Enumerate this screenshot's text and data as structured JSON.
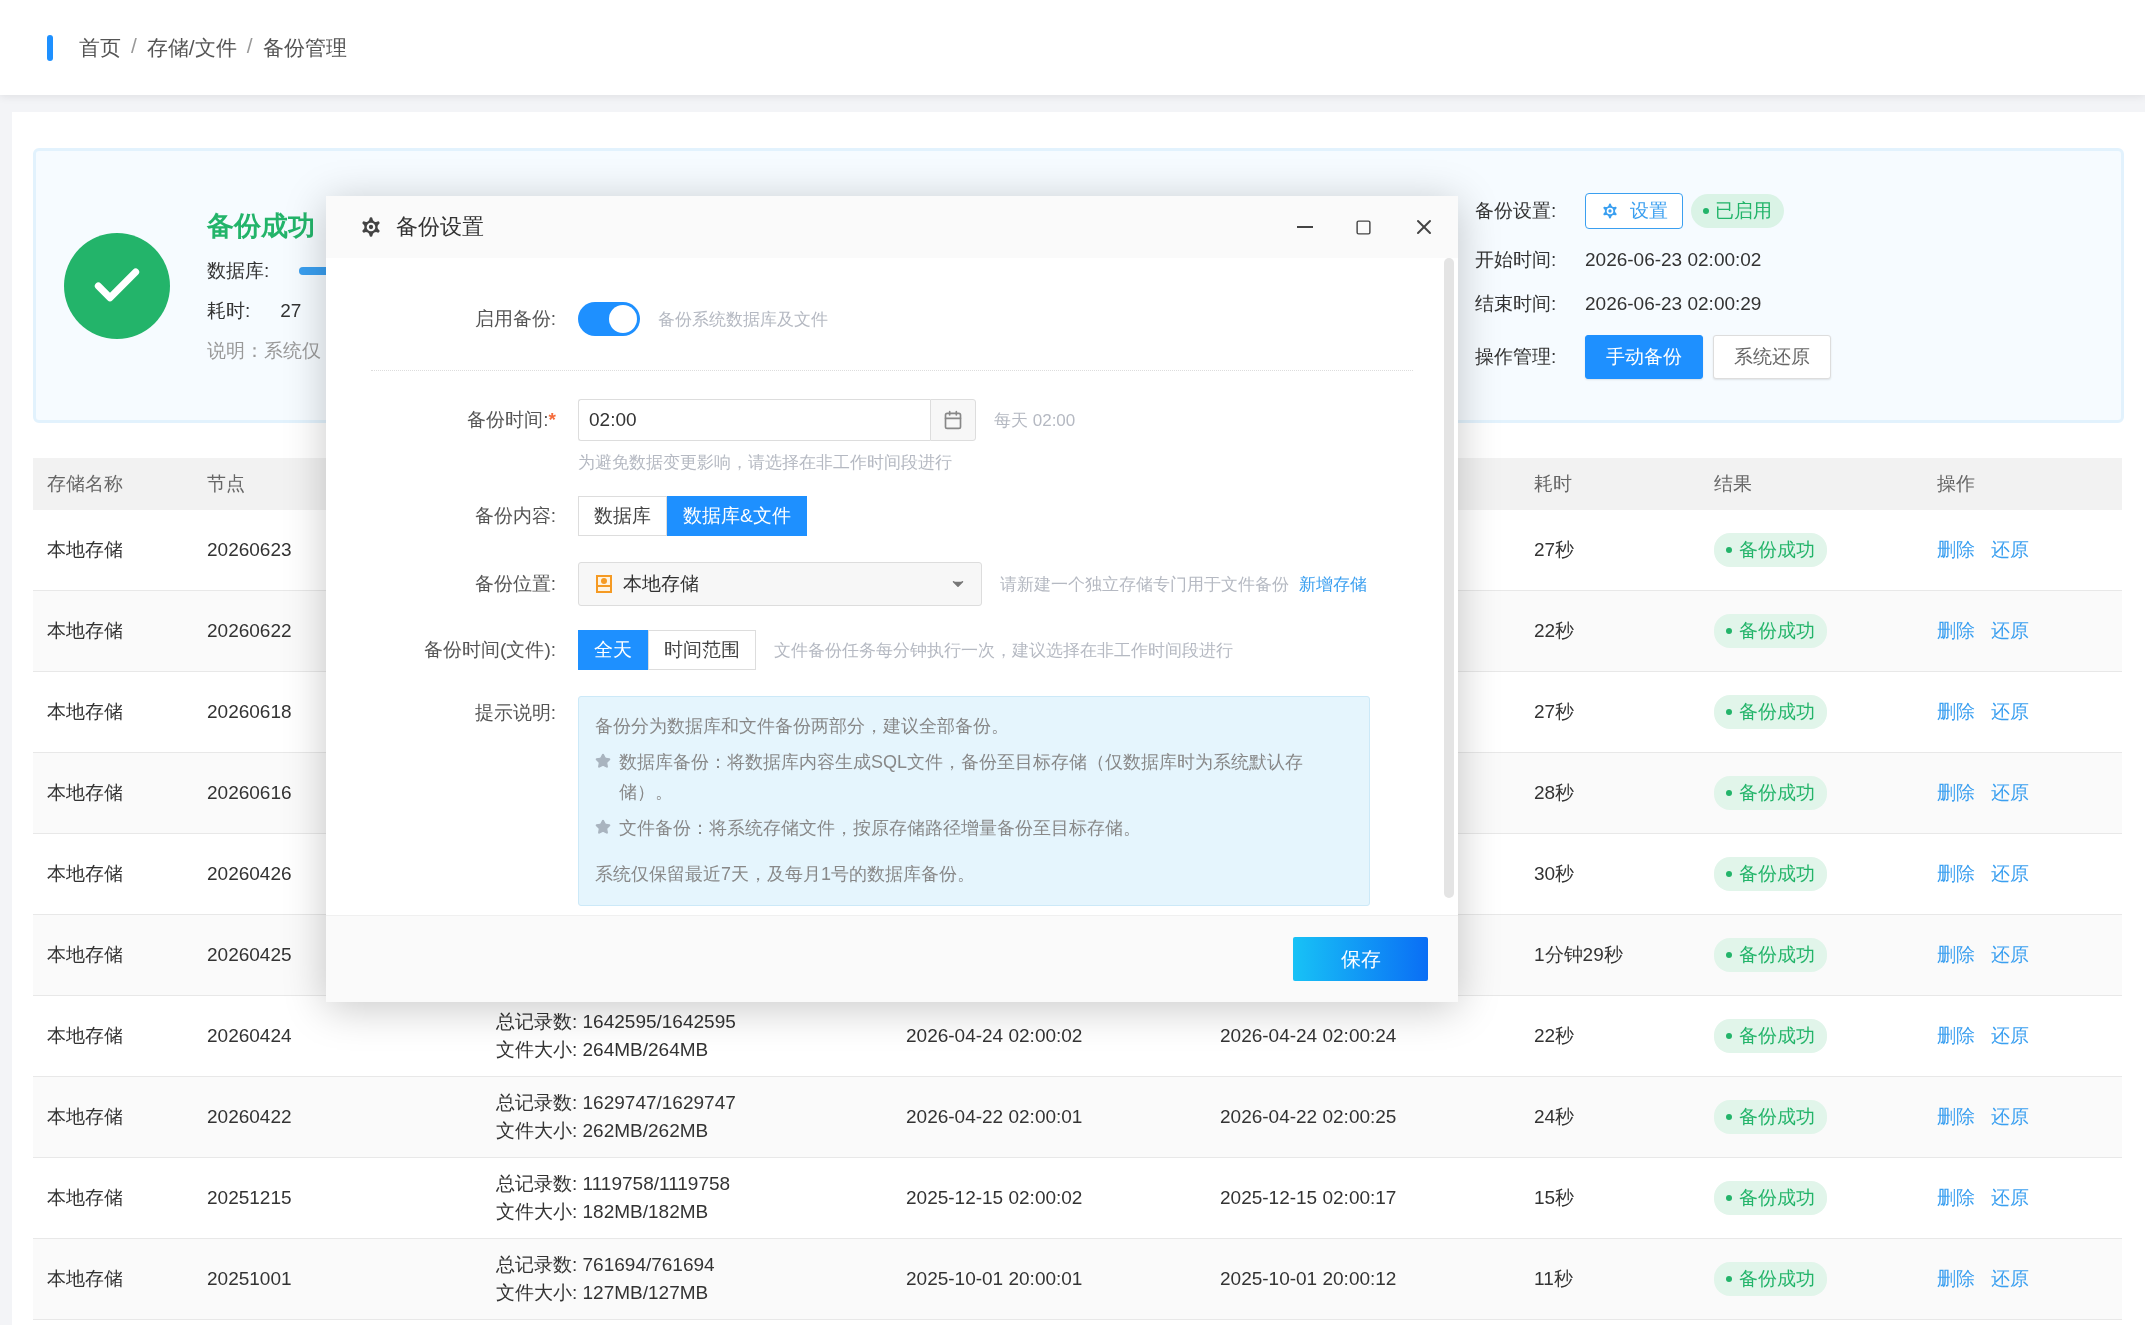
{
  "breadcrumb": {
    "separator": "/",
    "items": [
      "首页",
      "存储/文件",
      "备份管理"
    ]
  },
  "status": {
    "title": "备份成功",
    "db_label": "数据库:",
    "db_progress": {
      "level": 1
    },
    "duration_label": "耗时:",
    "duration": "27",
    "note": "说明：系统仅"
  },
  "summary": {
    "settings_label": "备份设置:",
    "settings_button": "设置",
    "enabled": true,
    "enabled_text": "已启用",
    "start_label": "开始时间:",
    "start": "2026-06-23 02:00:02",
    "end_label": "结束时间:",
    "end": "2026-06-23 02:00:29",
    "ops_label": "操作管理:",
    "buttons": [
      {
        "label": "手动备份",
        "kind": "primary"
      },
      {
        "label": "系统还原",
        "kind": "default"
      }
    ]
  },
  "table": {
    "headers": {
      "storage": "存储名称",
      "node": "节点",
      "duration": "耗时",
      "result": "结果",
      "actions": "操作"
    },
    "rows": [
      {
        "storage": "本地存储",
        "node": "20260623",
        "duration": "27秒",
        "result": "备份成功",
        "actions": [
          "删除",
          "还原"
        ]
      },
      {
        "storage": "本地存储",
        "node": "20260622",
        "duration": "22秒",
        "result": "备份成功",
        "actions": [
          "删除",
          "还原"
        ]
      },
      {
        "storage": "本地存储",
        "node": "20260618",
        "duration": "27秒",
        "result": "备份成功",
        "actions": [
          "删除",
          "还原"
        ]
      },
      {
        "storage": "本地存储",
        "node": "20260616",
        "duration": "28秒",
        "result": "备份成功",
        "actions": [
          "删除",
          "还原"
        ]
      },
      {
        "storage": "本地存储",
        "node": "20260426",
        "duration": "30秒",
        "result": "备份成功",
        "actions": [
          "删除",
          "还原"
        ]
      },
      {
        "storage": "本地存储",
        "node": "20260425",
        "duration": "1分钟29秒",
        "result": "备份成功",
        "actions": [
          "删除",
          "还原"
        ]
      },
      {
        "storage": "本地存储",
        "node": "20260424",
        "records": "总记录数: 1642595/1642595",
        "size": "文件大小: 264MB/264MB",
        "start": "2026-04-24 02:00:02",
        "end": "2026-04-24 02:00:24",
        "duration": "22秒",
        "result": "备份成功",
        "actions": [
          "删除",
          "还原"
        ]
      },
      {
        "storage": "本地存储",
        "node": "20260422",
        "records": "总记录数: 1629747/1629747",
        "size": "文件大小: 262MB/262MB",
        "start": "2026-04-22 02:00:01",
        "end": "2026-04-22 02:00:25",
        "duration": "24秒",
        "result": "备份成功",
        "actions": [
          "删除",
          "还原"
        ]
      },
      {
        "storage": "本地存储",
        "node": "20251215",
        "records": "总记录数: 1119758/1119758",
        "size": "文件大小: 182MB/182MB",
        "start": "2025-12-15 02:00:02",
        "end": "2025-12-15 02:00:17",
        "duration": "15秒",
        "result": "备份成功",
        "actions": [
          "删除",
          "还原"
        ]
      },
      {
        "storage": "本地存储",
        "node": "20251001",
        "records": "总记录数: 761694/761694",
        "size": "文件大小: 127MB/127MB",
        "start": "2025-10-01 20:00:01",
        "end": "2025-10-01 20:00:12",
        "duration": "11秒",
        "result": "备份成功",
        "actions": [
          "删除",
          "还原"
        ]
      }
    ]
  },
  "dialog": {
    "title": "备份设置",
    "enable": {
      "label": "启用备份:",
      "on": true,
      "hint": "备份系统数据库及文件"
    },
    "time": {
      "label": "备份时间:",
      "required_mark": "*",
      "value": "02:00",
      "after": "每天 02:00",
      "help": "为避免数据变更影响，请选择在非工作时间段进行"
    },
    "content": {
      "label": "备份内容:",
      "options": [
        {
          "label": "数据库",
          "selected": false
        },
        {
          "label": "数据库&文件",
          "selected": true
        }
      ]
    },
    "location": {
      "label": "备份位置:",
      "value": "本地存储",
      "hint": "请新建一个独立存储专门用于文件备份",
      "link": "新增存储"
    },
    "file_time": {
      "label": "备份时间(文件):",
      "options": [
        {
          "label": "全天",
          "selected": true
        },
        {
          "label": "时间范围",
          "selected": false
        }
      ],
      "hint": "文件备份任务每分钟执行一次，建议选择在非工作时间段进行"
    },
    "tips": {
      "label": "提示说明:",
      "lines": [
        {
          "kind": "plain",
          "text": "备份分为数据库和文件备份两部分，建议全部备份。"
        },
        {
          "kind": "star",
          "text": "数据库备份：将数据库内容生成SQL文件，备份至目标存储（仅数据库时为系统默认存储）。"
        },
        {
          "kind": "star",
          "text": "文件备份：将系统存储文件，按原存储路径增量备份至目标存储。"
        },
        {
          "kind": "note",
          "text": "系统仅保留最近7天，及每月1号的数据库备份。"
        }
      ]
    },
    "save": "保存"
  }
}
